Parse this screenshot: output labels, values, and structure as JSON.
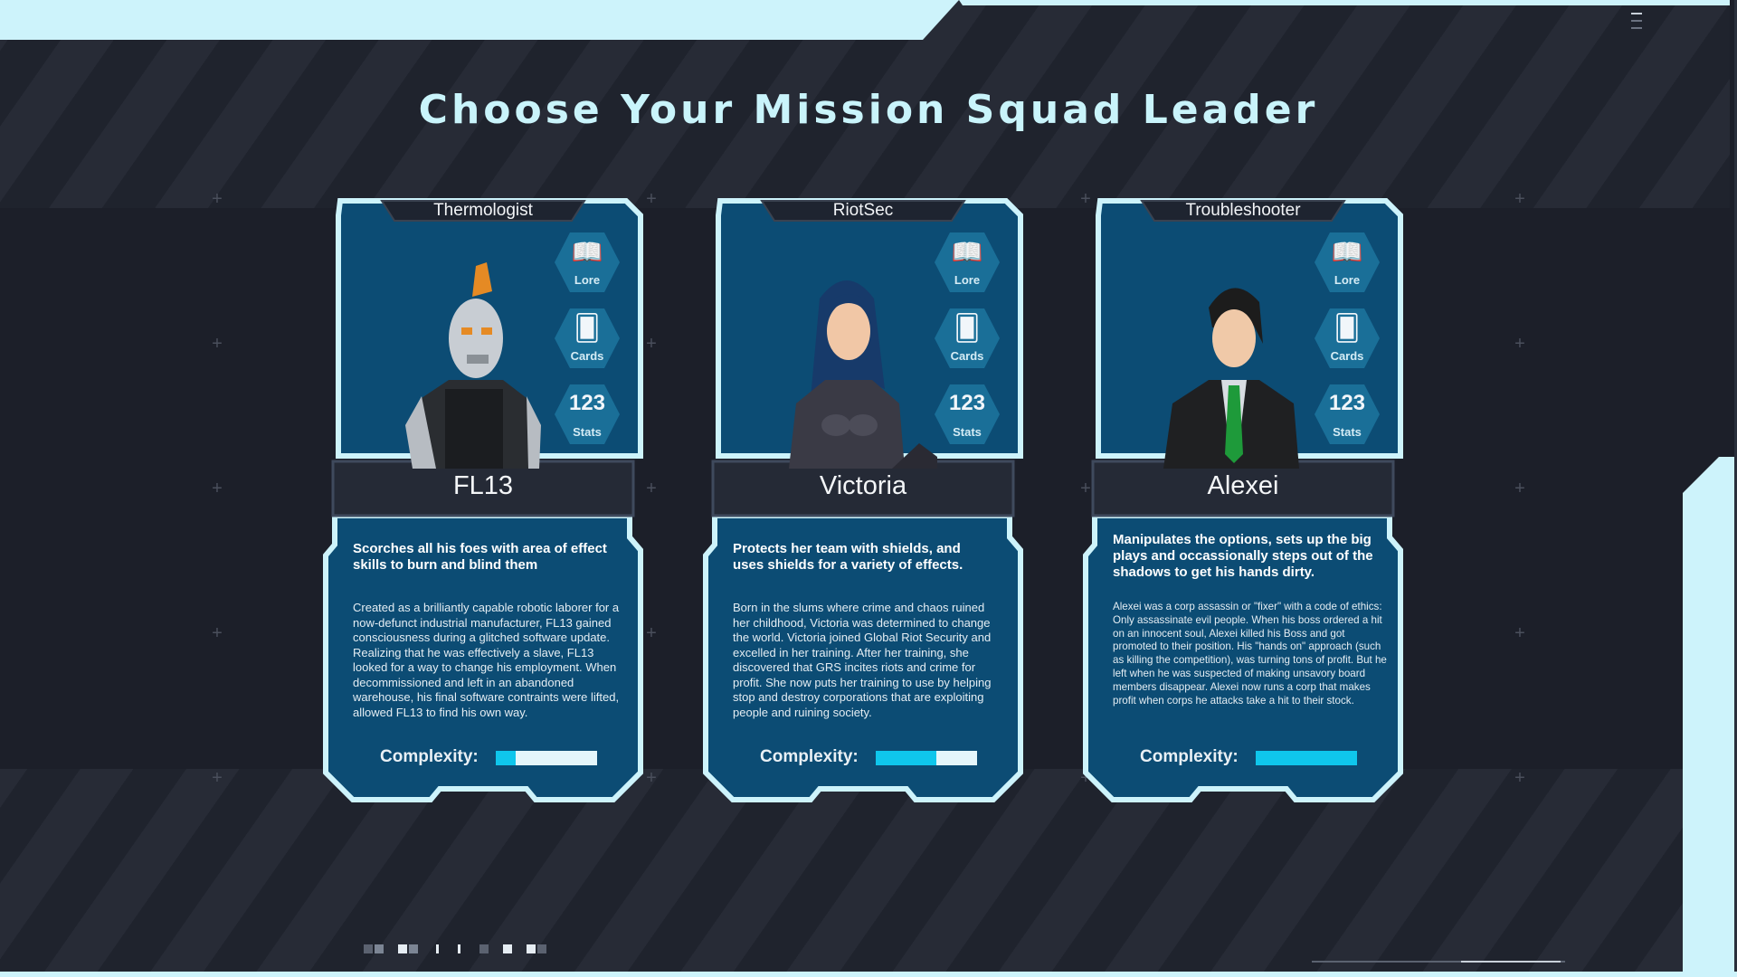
{
  "title": "Choose Your Mission Squad Leader",
  "colors": {
    "accent": "#0fc6ec",
    "card_bg": "#0c4c74",
    "card_border": "#cdf3fb",
    "title": "#c9f4fb"
  },
  "cards": [
    {
      "class": "Thermologist",
      "name": "FL13",
      "summary": "Scorches all his foes with area of effect skills to burn and blind them",
      "lore": "Created as a brilliantly capable robotic laborer for a now-defunct industrial manufacturer, FL13 gained consciousness during a glitched software update. Realizing that he was effectively a slave, FL13 looked for a way to change his employment. When decommissioned and left in an abandoned warehouse, his final software contraints were lifted, allowed FL13 to find his own way.",
      "complexity_label": "Complexity:",
      "complexity": 0.2,
      "buttons": {
        "lore": "Lore",
        "cards": "Cards",
        "stats": "Stats"
      },
      "buttons_icons": {
        "lore": "book-icon",
        "cards": "cards-icon",
        "stats": "123-stats-icon"
      }
    },
    {
      "class": "RiotSec",
      "name": "Victoria",
      "summary": "Protects her team with shields, and uses shields for a variety of effects.",
      "lore": "Born in the slums where crime and chaos ruined her childhood, Victoria was determined to change the world. Victoria joined Global Riot Security and excelled in her training. After her training, she discovered that GRS incites riots and crime for profit. She now puts her training to use by helping stop and destroy corporations that are exploiting people and ruining society.",
      "complexity_label": "Complexity:",
      "complexity": 0.6,
      "buttons": {
        "lore": "Lore",
        "cards": "Cards",
        "stats": "Stats"
      }
    },
    {
      "class": "Troubleshooter",
      "name": "Alexei",
      "summary": "Manipulates the options, sets up the big plays and occassionally steps out of the shadows to get his hands dirty.",
      "lore": "Alexei was a corp assassin or \"fixer\" with a code of ethics: Only assassinate evil people. When his boss ordered a hit on an innocent soul, Alexei killed his Boss and got promoted to their position. His \"hands on\" approach (such as killing the competition), was turning tons of profit. But he left when he was suspected of making unsavory board members disappear. Alexei now runs a corp that makes profit when corps he attacks take a hit to their stock.",
      "complexity_label": "Complexity:",
      "complexity": 1.0,
      "buttons": {
        "lore": "Lore",
        "cards": "Cards",
        "stats": "Stats"
      }
    }
  ]
}
